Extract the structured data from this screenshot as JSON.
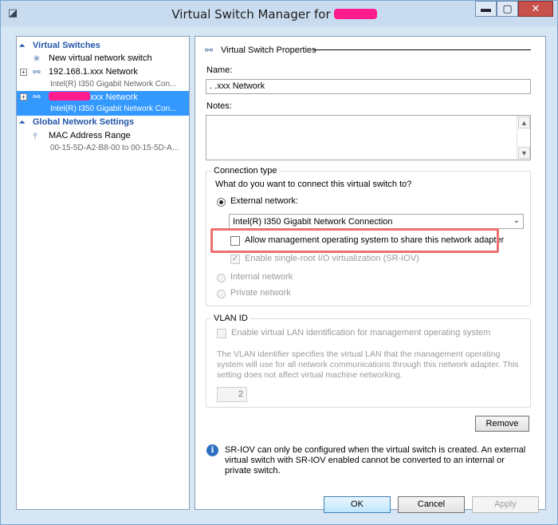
{
  "window": {
    "title": "Virtual Switch Manager for",
    "minimize_glyph": "▬",
    "maximize_glyph": "▢",
    "close_glyph": "✕",
    "app_icon": "◪"
  },
  "left_pane": {
    "virtual_switches_header": "Virtual Switches",
    "global_settings_header": "Global Network Settings",
    "new_switch_label": "New virtual network switch",
    "switches": [
      {
        "name": "192.168.1.xxx Network",
        "adapter": "Intel(R) I350 Gigabit Network Con..."
      },
      {
        "name": "xxx Network",
        "adapter": "Intel(R) I350 Gigabit Network Con..."
      }
    ],
    "mac_range_label": "MAC Address Range",
    "mac_range_value": "00-15-5D-A2-B8-00 to 00-15-5D-A..."
  },
  "right_pane": {
    "properties_header": "Virtual Switch Properties",
    "name_label": "Name:",
    "name_value": ".        .xxx Network",
    "notes_label": "Notes:",
    "notes_value": "",
    "connection_type_title": "Connection type",
    "connection_question": "What do you want to connect this virtual switch to?",
    "external_label": "External network:",
    "external_adapter": "Intel(R) I350 Gigabit Network Connection",
    "allow_mgmt_label": "Allow management operating system to share this network adapter",
    "sriov_label": "Enable single-root I/O virtualization (SR-IOV)",
    "internal_label": "Internal network",
    "private_label": "Private network",
    "vlan_title": "VLAN ID",
    "vlan_enable_label": "Enable virtual LAN identification for management operating system",
    "vlan_description": "The VLAN identifier specifies the virtual LAN that the management operating system will use for all network communications through this network adapter. This setting does not affect virtual machine networking.",
    "vlan_value": "2",
    "remove_label": "Remove",
    "info_text": "SR-IOV can only be configured when the virtual switch is created. An external virtual switch with SR-IOV enabled cannot be converted to an internal or private switch."
  },
  "footer": {
    "ok_label": "OK",
    "cancel_label": "Cancel",
    "apply_label": "Apply"
  },
  "state": {
    "connection_type": "external",
    "allow_mgmt_checked": false,
    "sriov_checked": true,
    "vlan_enabled": false,
    "selected_switch_index": 1
  },
  "colors": {
    "section_header": "#2456a8",
    "selection": "#3399ff",
    "highlight_box": "#f07070",
    "close_button": "#c7504a",
    "redaction": "#ff1c8c"
  }
}
